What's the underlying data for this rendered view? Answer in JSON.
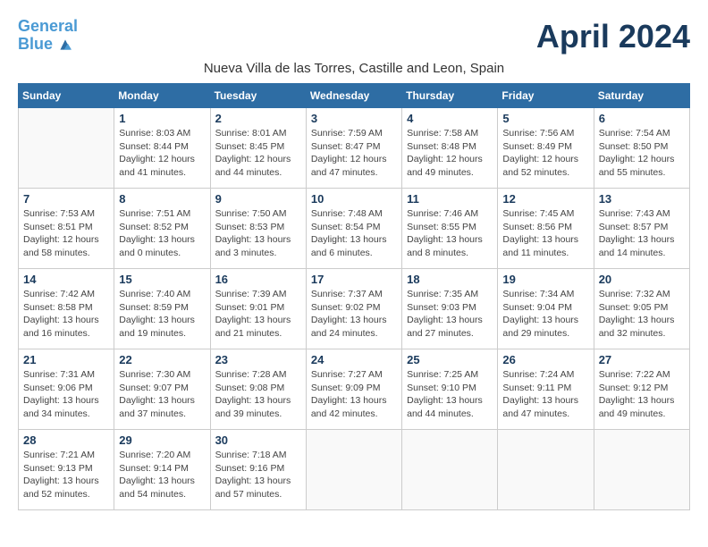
{
  "header": {
    "logo_line1": "General",
    "logo_line2": "Blue",
    "month_title": "April 2024",
    "location": "Nueva Villa de las Torres, Castille and Leon, Spain"
  },
  "weekdays": [
    "Sunday",
    "Monday",
    "Tuesday",
    "Wednesday",
    "Thursday",
    "Friday",
    "Saturday"
  ],
  "weeks": [
    [
      {
        "day": "",
        "sunrise": "",
        "sunset": "",
        "daylight": ""
      },
      {
        "day": "1",
        "sunrise": "Sunrise: 8:03 AM",
        "sunset": "Sunset: 8:44 PM",
        "daylight": "Daylight: 12 hours and 41 minutes."
      },
      {
        "day": "2",
        "sunrise": "Sunrise: 8:01 AM",
        "sunset": "Sunset: 8:45 PM",
        "daylight": "Daylight: 12 hours and 44 minutes."
      },
      {
        "day": "3",
        "sunrise": "Sunrise: 7:59 AM",
        "sunset": "Sunset: 8:47 PM",
        "daylight": "Daylight: 12 hours and 47 minutes."
      },
      {
        "day": "4",
        "sunrise": "Sunrise: 7:58 AM",
        "sunset": "Sunset: 8:48 PM",
        "daylight": "Daylight: 12 hours and 49 minutes."
      },
      {
        "day": "5",
        "sunrise": "Sunrise: 7:56 AM",
        "sunset": "Sunset: 8:49 PM",
        "daylight": "Daylight: 12 hours and 52 minutes."
      },
      {
        "day": "6",
        "sunrise": "Sunrise: 7:54 AM",
        "sunset": "Sunset: 8:50 PM",
        "daylight": "Daylight: 12 hours and 55 minutes."
      }
    ],
    [
      {
        "day": "7",
        "sunrise": "Sunrise: 7:53 AM",
        "sunset": "Sunset: 8:51 PM",
        "daylight": "Daylight: 12 hours and 58 minutes."
      },
      {
        "day": "8",
        "sunrise": "Sunrise: 7:51 AM",
        "sunset": "Sunset: 8:52 PM",
        "daylight": "Daylight: 13 hours and 0 minutes."
      },
      {
        "day": "9",
        "sunrise": "Sunrise: 7:50 AM",
        "sunset": "Sunset: 8:53 PM",
        "daylight": "Daylight: 13 hours and 3 minutes."
      },
      {
        "day": "10",
        "sunrise": "Sunrise: 7:48 AM",
        "sunset": "Sunset: 8:54 PM",
        "daylight": "Daylight: 13 hours and 6 minutes."
      },
      {
        "day": "11",
        "sunrise": "Sunrise: 7:46 AM",
        "sunset": "Sunset: 8:55 PM",
        "daylight": "Daylight: 13 hours and 8 minutes."
      },
      {
        "day": "12",
        "sunrise": "Sunrise: 7:45 AM",
        "sunset": "Sunset: 8:56 PM",
        "daylight": "Daylight: 13 hours and 11 minutes."
      },
      {
        "day": "13",
        "sunrise": "Sunrise: 7:43 AM",
        "sunset": "Sunset: 8:57 PM",
        "daylight": "Daylight: 13 hours and 14 minutes."
      }
    ],
    [
      {
        "day": "14",
        "sunrise": "Sunrise: 7:42 AM",
        "sunset": "Sunset: 8:58 PM",
        "daylight": "Daylight: 13 hours and 16 minutes."
      },
      {
        "day": "15",
        "sunrise": "Sunrise: 7:40 AM",
        "sunset": "Sunset: 8:59 PM",
        "daylight": "Daylight: 13 hours and 19 minutes."
      },
      {
        "day": "16",
        "sunrise": "Sunrise: 7:39 AM",
        "sunset": "Sunset: 9:01 PM",
        "daylight": "Daylight: 13 hours and 21 minutes."
      },
      {
        "day": "17",
        "sunrise": "Sunrise: 7:37 AM",
        "sunset": "Sunset: 9:02 PM",
        "daylight": "Daylight: 13 hours and 24 minutes."
      },
      {
        "day": "18",
        "sunrise": "Sunrise: 7:35 AM",
        "sunset": "Sunset: 9:03 PM",
        "daylight": "Daylight: 13 hours and 27 minutes."
      },
      {
        "day": "19",
        "sunrise": "Sunrise: 7:34 AM",
        "sunset": "Sunset: 9:04 PM",
        "daylight": "Daylight: 13 hours and 29 minutes."
      },
      {
        "day": "20",
        "sunrise": "Sunrise: 7:32 AM",
        "sunset": "Sunset: 9:05 PM",
        "daylight": "Daylight: 13 hours and 32 minutes."
      }
    ],
    [
      {
        "day": "21",
        "sunrise": "Sunrise: 7:31 AM",
        "sunset": "Sunset: 9:06 PM",
        "daylight": "Daylight: 13 hours and 34 minutes."
      },
      {
        "day": "22",
        "sunrise": "Sunrise: 7:30 AM",
        "sunset": "Sunset: 9:07 PM",
        "daylight": "Daylight: 13 hours and 37 minutes."
      },
      {
        "day": "23",
        "sunrise": "Sunrise: 7:28 AM",
        "sunset": "Sunset: 9:08 PM",
        "daylight": "Daylight: 13 hours and 39 minutes."
      },
      {
        "day": "24",
        "sunrise": "Sunrise: 7:27 AM",
        "sunset": "Sunset: 9:09 PM",
        "daylight": "Daylight: 13 hours and 42 minutes."
      },
      {
        "day": "25",
        "sunrise": "Sunrise: 7:25 AM",
        "sunset": "Sunset: 9:10 PM",
        "daylight": "Daylight: 13 hours and 44 minutes."
      },
      {
        "day": "26",
        "sunrise": "Sunrise: 7:24 AM",
        "sunset": "Sunset: 9:11 PM",
        "daylight": "Daylight: 13 hours and 47 minutes."
      },
      {
        "day": "27",
        "sunrise": "Sunrise: 7:22 AM",
        "sunset": "Sunset: 9:12 PM",
        "daylight": "Daylight: 13 hours and 49 minutes."
      }
    ],
    [
      {
        "day": "28",
        "sunrise": "Sunrise: 7:21 AM",
        "sunset": "Sunset: 9:13 PM",
        "daylight": "Daylight: 13 hours and 52 minutes."
      },
      {
        "day": "29",
        "sunrise": "Sunrise: 7:20 AM",
        "sunset": "Sunset: 9:14 PM",
        "daylight": "Daylight: 13 hours and 54 minutes."
      },
      {
        "day": "30",
        "sunrise": "Sunrise: 7:18 AM",
        "sunset": "Sunset: 9:16 PM",
        "daylight": "Daylight: 13 hours and 57 minutes."
      },
      {
        "day": "",
        "sunrise": "",
        "sunset": "",
        "daylight": ""
      },
      {
        "day": "",
        "sunrise": "",
        "sunset": "",
        "daylight": ""
      },
      {
        "day": "",
        "sunrise": "",
        "sunset": "",
        "daylight": ""
      },
      {
        "day": "",
        "sunrise": "",
        "sunset": "",
        "daylight": ""
      }
    ]
  ]
}
